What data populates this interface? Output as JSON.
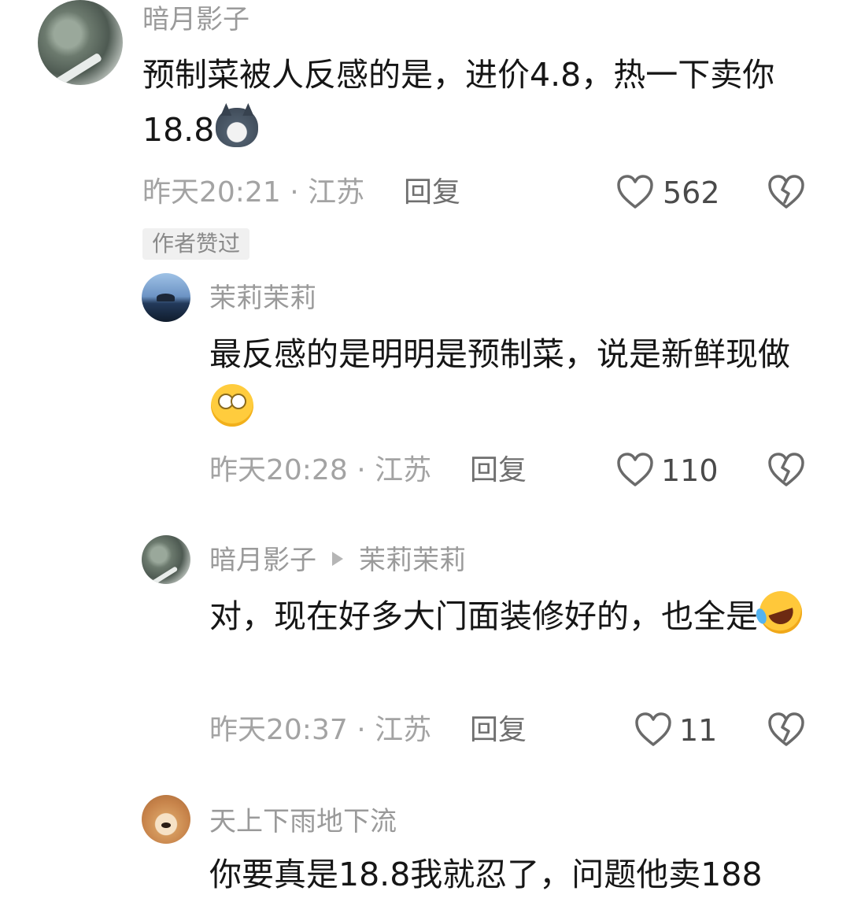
{
  "comments": [
    {
      "user": "暗月影子",
      "text": "预制菜被人反感的是，进价4.8，热一下卖你18.8",
      "emoji": "husky-emoji",
      "time_location": "昨天20:21 · 江苏",
      "reply_label": "回复",
      "likes": "562",
      "author_badge": "作者赞过",
      "replies": [
        {
          "user": "茉莉茉莉",
          "text": "最反感的是明明是预制菜，说是新鲜现做",
          "emoji": "eyes-emoji",
          "time_location": "昨天20:28 · 江苏",
          "reply_label": "回复",
          "likes": "110"
        },
        {
          "user": "暗月影子",
          "reply_to": "茉莉茉莉",
          "text": "对，现在好多大门面装修好的，也全是",
          "emoji": "laughing-tears-emoji",
          "time_location": "昨天20:37 · 江苏",
          "reply_label": "回复",
          "likes": "11"
        },
        {
          "user": "天上下雨地下流",
          "text": "你要真是18.8我就忍了，问题他卖188"
        }
      ]
    }
  ],
  "icons": {
    "like": "heart-outline-icon",
    "dislike": "broken-heart-icon",
    "reply_arrow": "play-triangle-icon"
  },
  "colors": {
    "name": "#9a9a9a",
    "text": "#161616",
    "meta": "#a3a3a3",
    "icon": "#6a6a6a"
  }
}
